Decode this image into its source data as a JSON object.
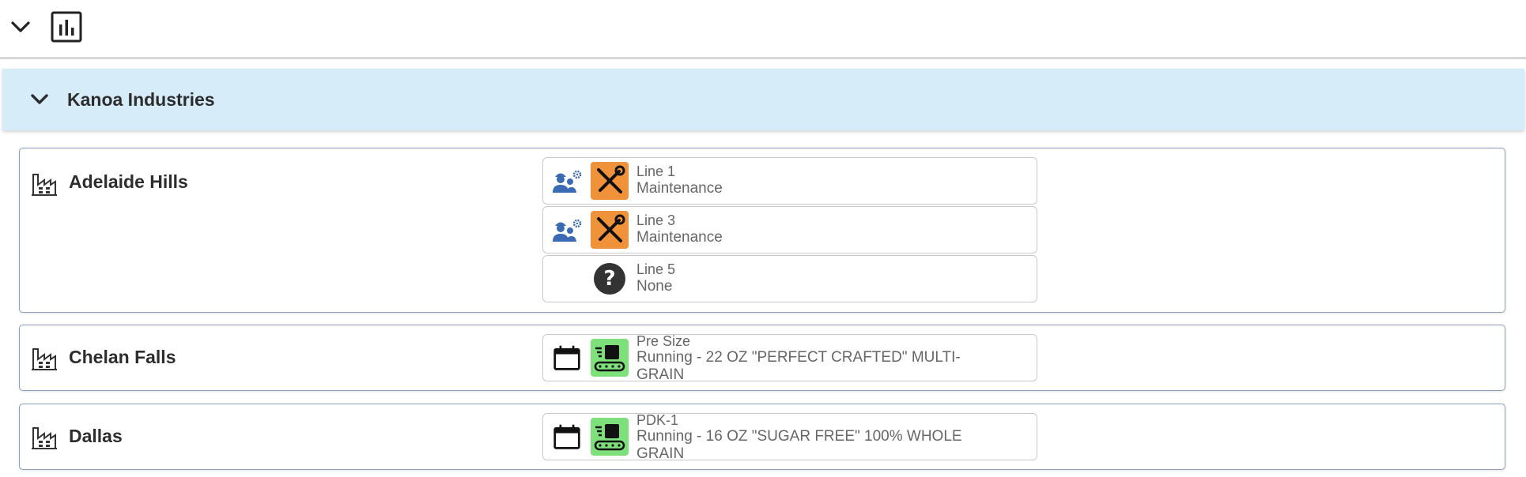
{
  "toolbar": {
    "collapse_icon": "chevron-down-icon",
    "chart_icon": "bar-chart-icon"
  },
  "company": {
    "name": "Kanoa Industries",
    "background": "#d6edf9"
  },
  "sites": [
    {
      "name": "Adelaide Hills",
      "lines": [
        {
          "name": "Line 1",
          "status": "Maintenance",
          "state_icon": "maintenance-tools-icon",
          "state_color": "#f0923a",
          "mode_icon": "workers-gear-icon"
        },
        {
          "name": "Line 3",
          "status": "Maintenance",
          "state_icon": "maintenance-tools-icon",
          "state_color": "#f0923a",
          "mode_icon": "workers-gear-icon"
        },
        {
          "name": "Line 5",
          "status": "None",
          "state_icon": "question-icon",
          "state_color": "#333333",
          "mode_icon": ""
        }
      ]
    },
    {
      "name": "Chelan Falls",
      "lines": [
        {
          "name": "Pre Size",
          "status": "Running - 22 OZ \"PERFECT CRAFTED\" MULTI-GRAIN",
          "state_icon": "conveyor-running-icon",
          "state_color": "#7ee07a",
          "mode_icon": "calendar-icon"
        }
      ]
    },
    {
      "name": "Dallas",
      "lines": [
        {
          "name": "PDK-1",
          "status": "Running - 16 OZ \"SUGAR FREE\" 100% WHOLE GRAIN",
          "state_icon": "conveyor-running-icon",
          "state_color": "#7ee07a",
          "mode_icon": "calendar-icon"
        }
      ]
    }
  ]
}
